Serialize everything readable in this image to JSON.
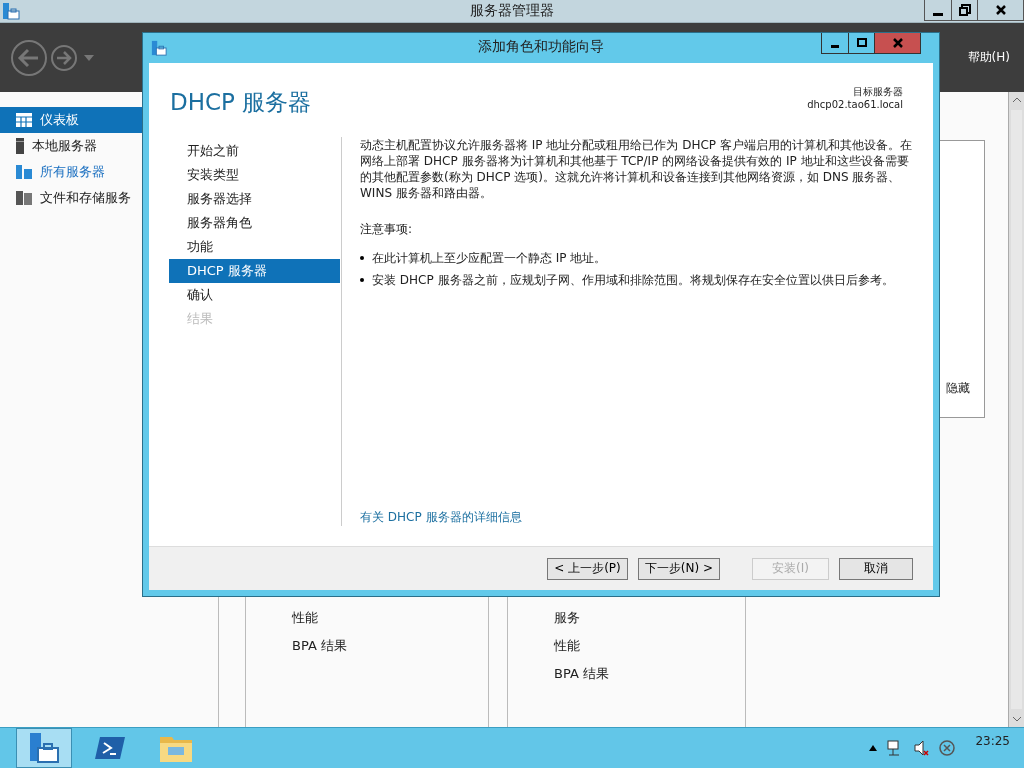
{
  "window": {
    "title": "服务器管理器"
  },
  "menu": [
    {
      "label": "帮助(H)"
    }
  ],
  "sidebar": {
    "items": [
      {
        "label": "仪表板",
        "kind": "grid",
        "selected": true
      },
      {
        "label": "本地服务器",
        "kind": "server",
        "selected": false
      },
      {
        "label": "所有服务器",
        "kind": "servers",
        "selected": false
      },
      {
        "label": "文件和存储服务",
        "kind": "files",
        "selected": false
      }
    ]
  },
  "panel": {
    "link": "隐藏"
  },
  "tiles": [
    {
      "items": [
        "性能",
        "BPA 结果"
      ]
    },
    {
      "items": [
        "服务",
        "性能",
        "BPA 结果"
      ]
    }
  ],
  "dialog": {
    "title": "添加角色和功能向导",
    "heading": "DHCP 服务器",
    "target_label": "目标服务器",
    "target_server": "dhcp02.tao61.local",
    "steps": [
      {
        "label": "开始之前",
        "selected": false,
        "disabled": false
      },
      {
        "label": "安装类型",
        "selected": false,
        "disabled": false
      },
      {
        "label": "服务器选择",
        "selected": false,
        "disabled": false
      },
      {
        "label": "服务器角色",
        "selected": false,
        "disabled": false
      },
      {
        "label": "功能",
        "selected": false,
        "disabled": false
      },
      {
        "label": "DHCP 服务器",
        "selected": true,
        "disabled": false
      },
      {
        "label": "确认",
        "selected": false,
        "disabled": false
      },
      {
        "label": "结果",
        "selected": false,
        "disabled": true
      }
    ],
    "description": "动态主机配置协议允许服务器将 IP 地址分配或租用给已作为 DHCP 客户端启用的计算机和其他设备。在网络上部署 DHCP 服务器将为计算机和其他基于 TCP/IP 的网络设备提供有效的 IP 地址和这些设备需要的其他配置参数(称为 DHCP 选项)。这就允许将计算机和设备连接到其他网络资源，如 DNS 服务器、WINS 服务器和路由器。",
    "notes_heading": "注意事项:",
    "notes": [
      "在此计算机上至少应配置一个静态 IP 地址。",
      "安装 DHCP 服务器之前，应规划子网、作用域和排除范围。将规划保存在安全位置以供日后参考。"
    ],
    "more_link": "有关 DHCP 服务器的详细信息",
    "buttons": [
      {
        "label": "< 上一步(P)",
        "disabled": false
      },
      {
        "label": "下一步(N) >",
        "disabled": false
      },
      {
        "label": "安装(I)",
        "disabled": true
      },
      {
        "label": "取消",
        "disabled": false
      }
    ]
  },
  "taskbar": {
    "apps": [
      {
        "kind": "server-manager",
        "selected": true
      },
      {
        "kind": "powershell",
        "selected": false
      },
      {
        "kind": "explorer",
        "selected": false
      }
    ],
    "clock": "23:25"
  }
}
